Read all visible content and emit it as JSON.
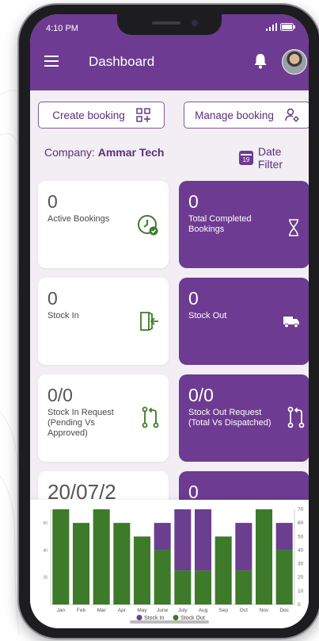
{
  "status_bar": {
    "time": "4:10 PM"
  },
  "app_bar": {
    "title": "Dashboard"
  },
  "actions": {
    "create_booking": "Create booking",
    "manage_booking": "Manage booking"
  },
  "company": {
    "label": "Company:",
    "name": "Ammar Tech"
  },
  "date_filter": {
    "calendar_day": "19",
    "label": "Date Filter"
  },
  "tiles": [
    {
      "value": "0",
      "label": "Active Bookings",
      "style": "white",
      "icon": "clock-check-icon"
    },
    {
      "value": "0",
      "label": "Total Completed Bookings",
      "style": "purple",
      "icon": "hourglass-icon"
    },
    {
      "value": "0",
      "label": "Stock In",
      "style": "white",
      "icon": "door-enter-icon"
    },
    {
      "value": "0",
      "label": "Stock Out",
      "style": "purple",
      "icon": "truck-icon"
    },
    {
      "value": "0/0",
      "label": "Stock In Request (Pending Vs Approved)",
      "style": "white",
      "icon": "pull-request-icon"
    },
    {
      "value": "0/0",
      "label": "Stock Out Request (Total Vs Dispatched)",
      "style": "purple",
      "icon": "pull-request-icon"
    },
    {
      "value": "20/07/2",
      "label": "",
      "style": "white",
      "icon": ""
    },
    {
      "value": "0",
      "label": "",
      "style": "purple",
      "icon": ""
    }
  ],
  "colors": {
    "primary": "#6d3b91",
    "stock_in": "#6b3e8f",
    "stock_out": "#3d7a2a"
  },
  "chart_data": {
    "type": "bar",
    "categories": [
      "Jan",
      "Feb",
      "Mar",
      "Apr",
      "May",
      "June",
      "July",
      "Aug",
      "Sep",
      "Oct",
      "Nov",
      "Dec"
    ],
    "series": [
      {
        "name": "Stock In",
        "values": [
          0,
          0,
          0,
          0,
          0,
          20,
          45,
          45,
          0,
          35,
          0,
          20
        ]
      },
      {
        "name": "Stock Out",
        "values": [
          70,
          60,
          70,
          60,
          50,
          40,
          25,
          25,
          50,
          25,
          70,
          40
        ]
      }
    ],
    "left_ticks": [
      "60",
      "40",
      "20"
    ],
    "right_ticks": [
      "70",
      "60",
      "50",
      "40",
      "30",
      "20",
      "10",
      "0"
    ],
    "ylim": [
      0,
      70
    ],
    "legend_placement": "bottom"
  }
}
